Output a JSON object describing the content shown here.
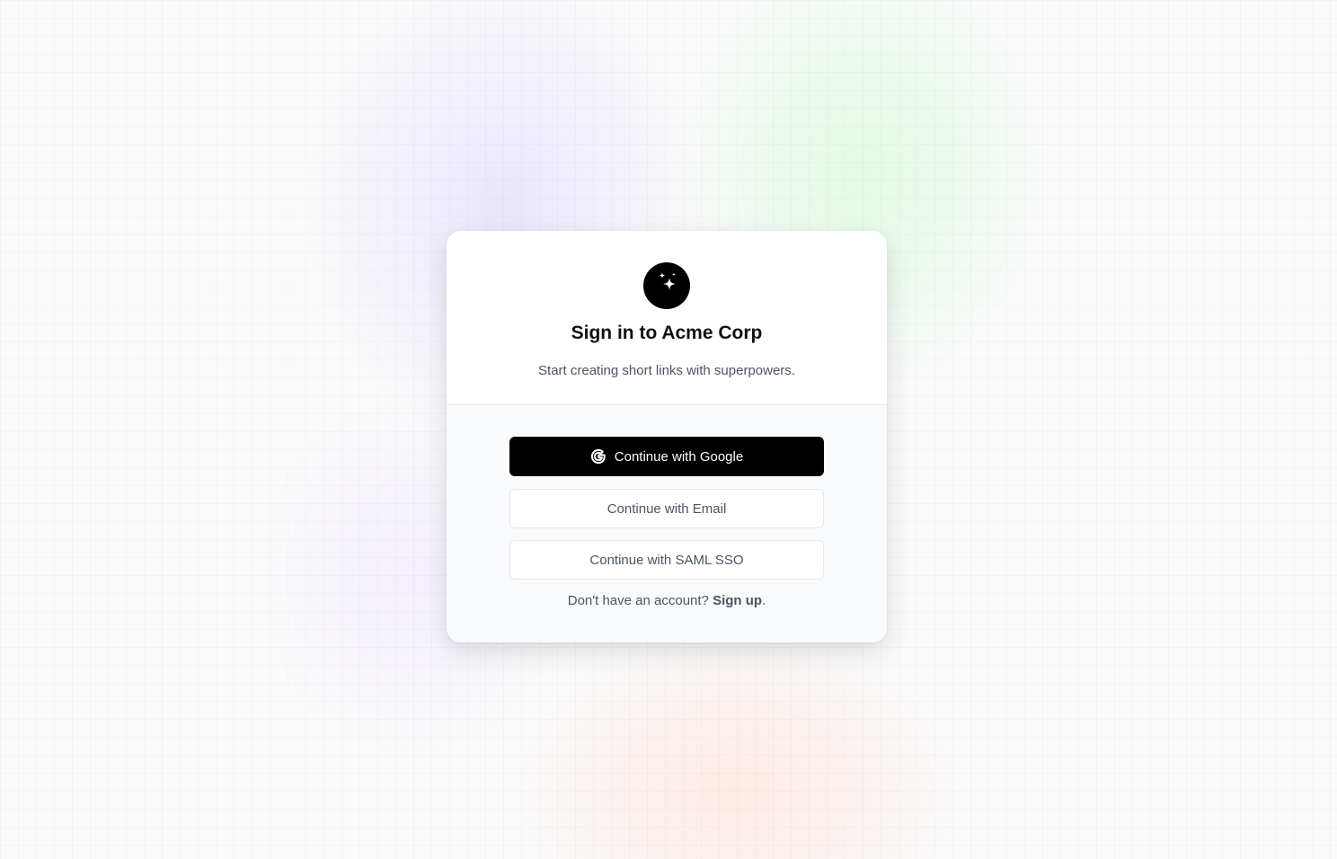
{
  "page": {
    "title": "Sign in to Acme Corp",
    "subtitle": "Start creating short links with superpowers."
  },
  "logo": {
    "icon": "sparkles-icon",
    "background_color": "#000000"
  },
  "buttons": {
    "google_label": "Continue with Google",
    "google_icon": "google-icon",
    "email_label": "Continue with Email",
    "saml_label": "Continue with SAML SSO"
  },
  "footer": {
    "prompt": "Don't have an account?",
    "signup_label": "Sign up",
    "suffix": "."
  },
  "colors": {
    "primary_button_bg": "#000000",
    "primary_button_text": "#ffffff",
    "secondary_text": "#4b5563"
  }
}
